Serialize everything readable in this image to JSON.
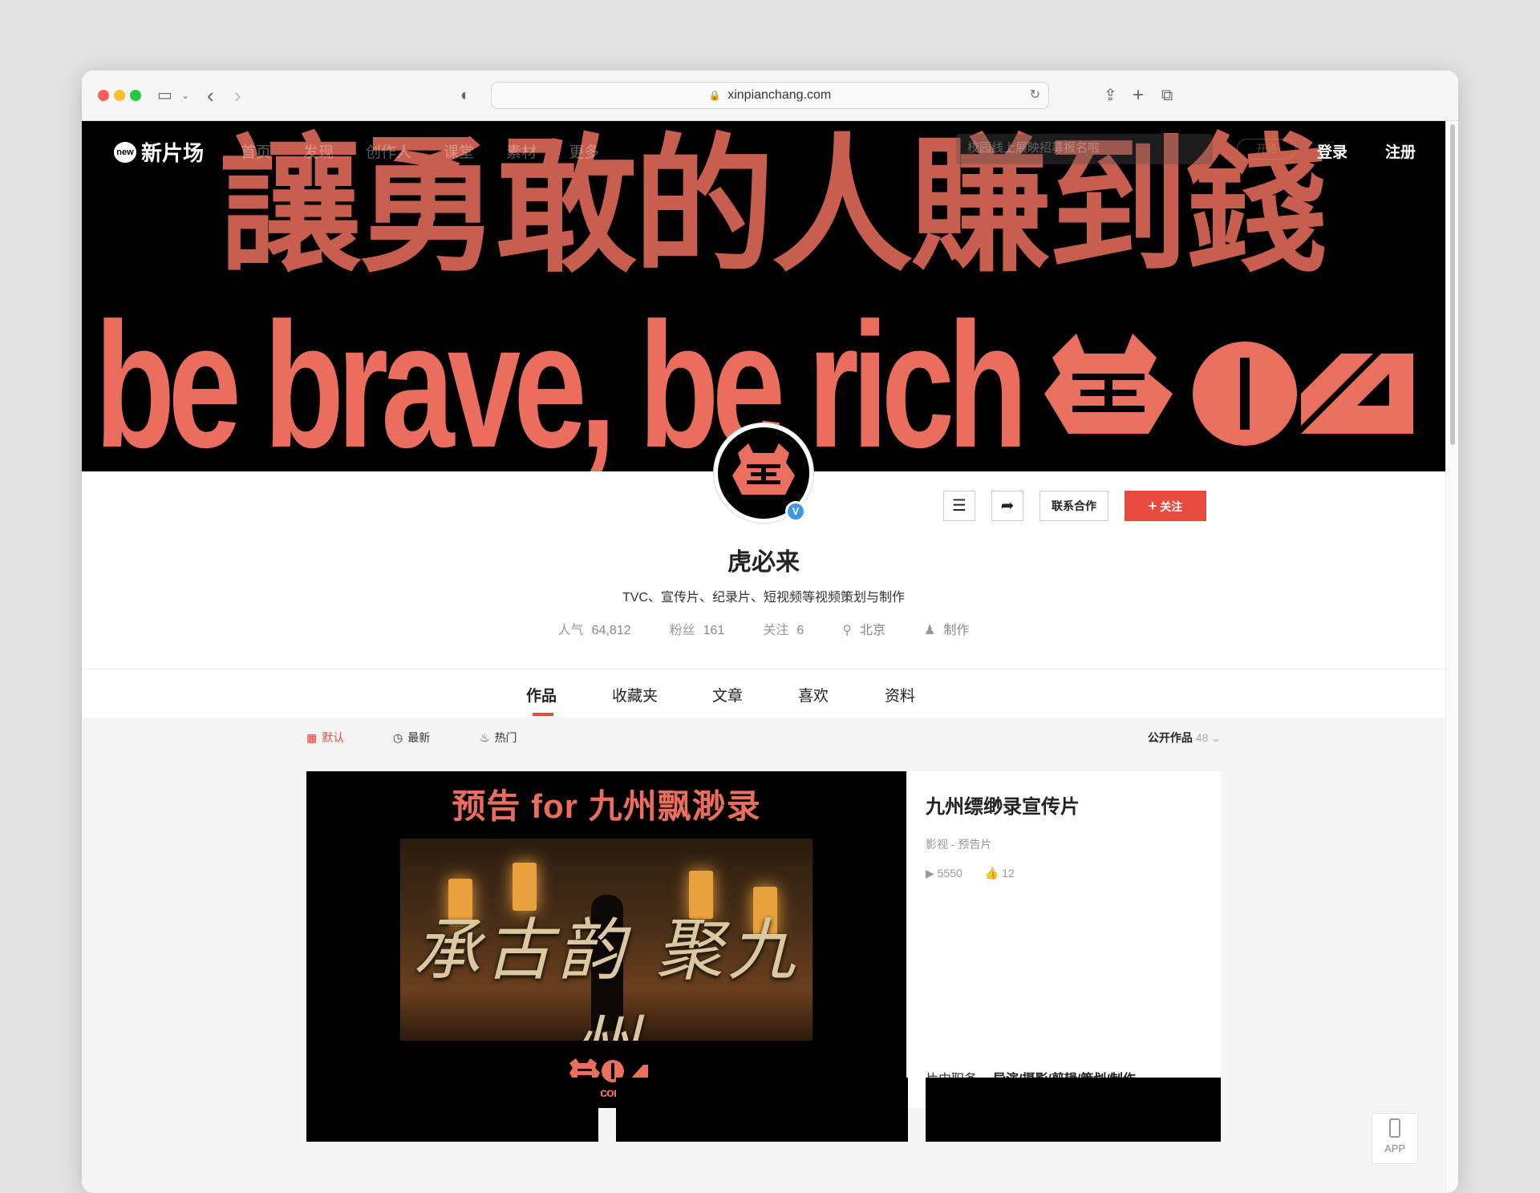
{
  "browser": {
    "url": "xinpianchang.com",
    "buttons": [
      "sidebar-toggle",
      "back",
      "forward",
      "share",
      "new-tab",
      "tab-overview"
    ]
  },
  "nav": {
    "brand_badge": "new",
    "brand": "新片场",
    "links": [
      "首页",
      "发现",
      "创作人",
      "课堂",
      "素材",
      "更多"
    ],
    "search_placeholder": "校园线上展映招募报名啦",
    "vip": "开通",
    "login": "登录",
    "signup": "注册"
  },
  "banner": {
    "headline_cn": "讓勇敢的人賺到錢",
    "headline_en": "be brave, be rich",
    "colors": {
      "cn": "#c85e4f",
      "en": "#ea6d5e",
      "bg": "#000000"
    }
  },
  "profile": {
    "name": "虎必来",
    "description": "TVC、宣传片、纪录片、短视频等视频策划与制作",
    "verified_badge": "V",
    "stats": [
      {
        "label": "人气",
        "value": "64,812"
      },
      {
        "label": "粉丝",
        "value": "161"
      },
      {
        "label": "关注",
        "value": "6"
      },
      {
        "label": "",
        "value": "北京",
        "icon": "location-pin-icon"
      },
      {
        "label": "",
        "value": "制作",
        "icon": "person-icon"
      }
    ],
    "contact_button": "联系合作",
    "follow_button": "关注",
    "follow_icon": "+"
  },
  "tabs": {
    "items": [
      "作品",
      "收藏夹",
      "文章",
      "喜欢",
      "资料"
    ],
    "active": 0
  },
  "filters": {
    "items": [
      {
        "label": "默认",
        "icon": "grid-icon",
        "active": true
      },
      {
        "label": "最新",
        "icon": "clock-icon",
        "active": false
      },
      {
        "label": "热门",
        "icon": "flame-icon",
        "active": false
      }
    ],
    "public_label": "公开作品",
    "public_count": "48"
  },
  "featured": {
    "thumb_title": "预告 for 九州飘渺录",
    "thumb_caption": "承古韵 聚九州",
    "thumb_brand": "tiger coming",
    "title": "九州缥缈录宣传片",
    "category": "影视 - 预告片",
    "plays": "5550",
    "likes": "12",
    "role_label": "片中职务",
    "role_value": "导演/摄影/剪辑/策划/制作"
  },
  "app_button": "APP",
  "accent_color": "#e84a40"
}
